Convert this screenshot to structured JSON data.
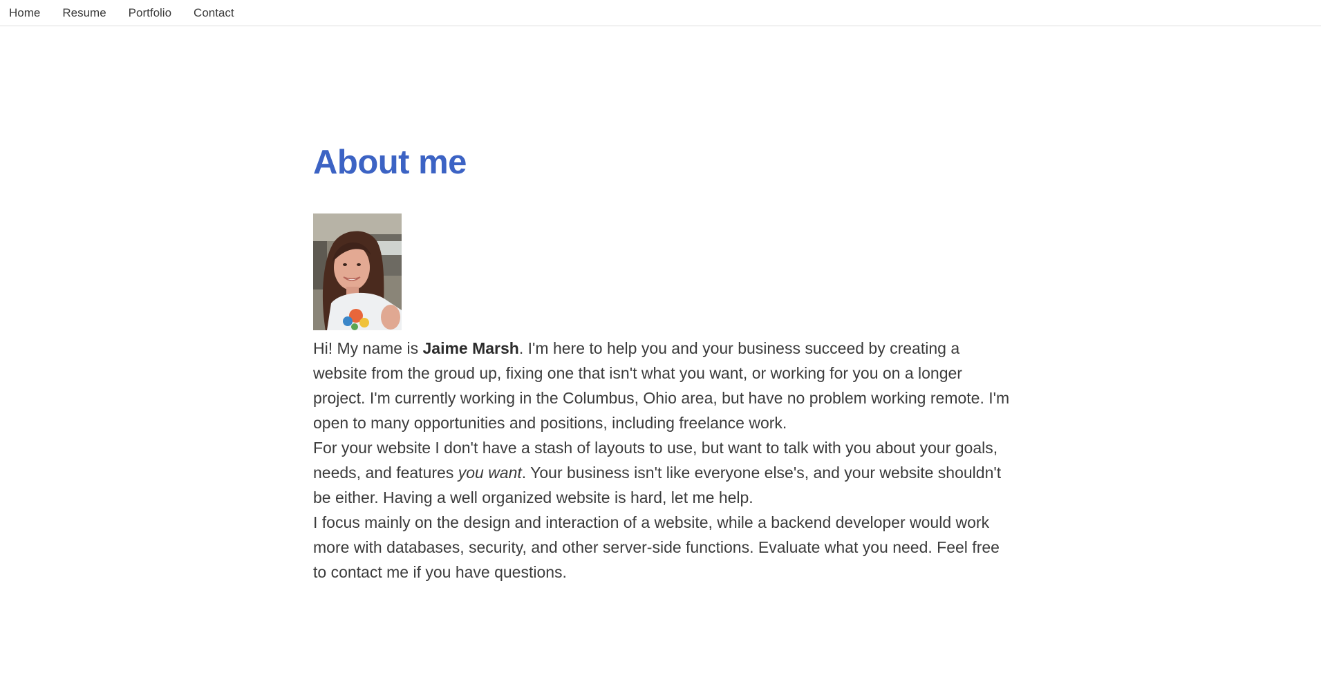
{
  "nav": {
    "items": [
      {
        "label": "Home"
      },
      {
        "label": "Resume"
      },
      {
        "label": "Portfolio"
      },
      {
        "label": "Contact"
      }
    ]
  },
  "main": {
    "title": "About me",
    "portrait_icon": "person-photo",
    "paragraphs": {
      "p1": {
        "pre": "Hi! My name is ",
        "name": "Jaime Marsh",
        "post": ". I'm here to help you and your business succeed by creating a website from the groud up, fixing one that isn't what you want, or working for you on a longer project. I'm currently working in the Columbus, Ohio area, but have no problem working remote. I'm open to many opportunities and positions, including freelance work."
      },
      "p2": {
        "pre": "For your website I don't have a stash of layouts to use, but want to talk with you about your goals, needs, and features ",
        "emphasis": "you want",
        "post": ". Your business isn't like everyone else's, and your website shouldn't be either. Having a well organized website is hard, let me help."
      },
      "p3": {
        "text": "I focus mainly on the design and interaction of a website, while a backend developer would work more with databases, security, and other server-side functions. Evaluate what you need. Feel free to contact me if you have questions."
      }
    }
  },
  "colors": {
    "title": "#3c63c4",
    "body_text": "#3b3b3b",
    "nav_text": "#3a3a3a",
    "divider": "#dddddd"
  }
}
